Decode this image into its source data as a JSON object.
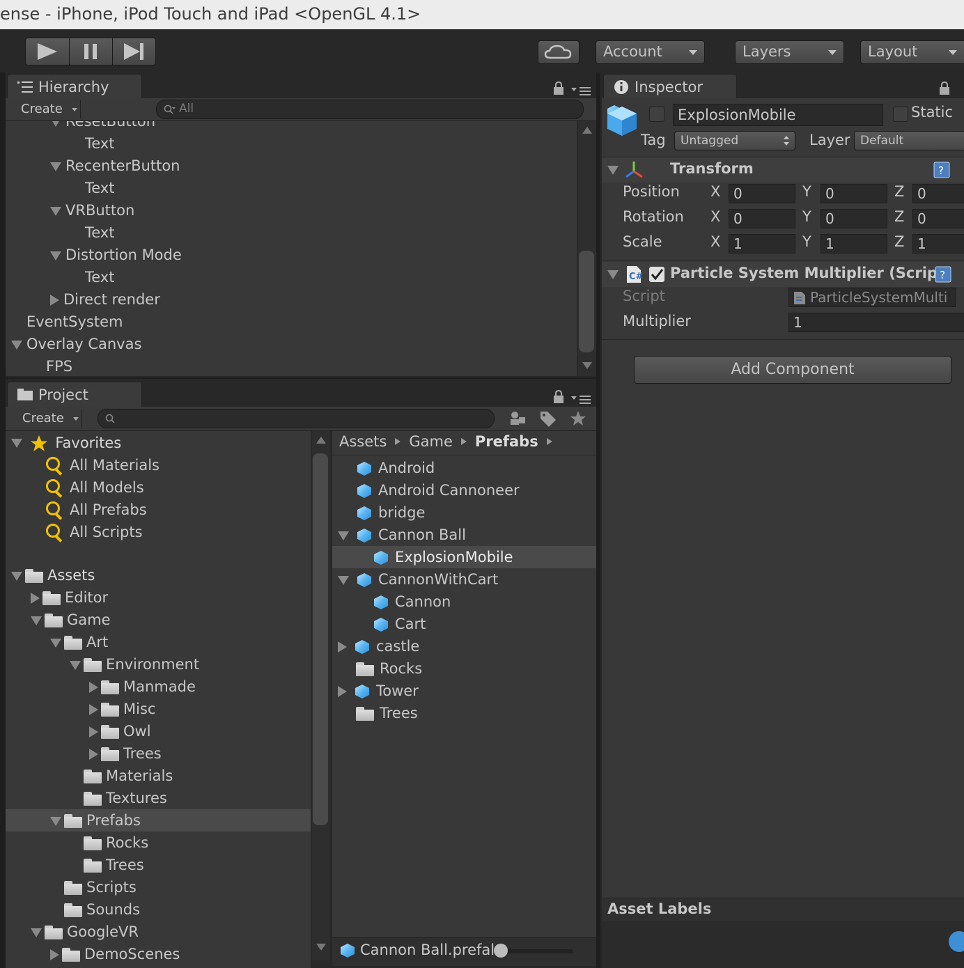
{
  "window": {
    "title": "ense - iPhone, iPod Touch and iPad <OpenGL 4.1>"
  },
  "toolbar": {
    "account": "Account",
    "layers": "Layers",
    "layout": "Layout"
  },
  "hierarchy": {
    "tab": "Hierarchy",
    "create": "Create",
    "search_placeholder": "All",
    "items": [
      {
        "label": "ResetButton",
        "indent": 3,
        "expander": "down"
      },
      {
        "label": "Text",
        "indent": 4,
        "expander": "none"
      },
      {
        "label": "RecenterButton",
        "indent": 3,
        "expander": "down"
      },
      {
        "label": "Text",
        "indent": 4,
        "expander": "none"
      },
      {
        "label": "VRButton",
        "indent": 3,
        "expander": "down"
      },
      {
        "label": "Text",
        "indent": 4,
        "expander": "none"
      },
      {
        "label": "Distortion Mode",
        "indent": 3,
        "expander": "down"
      },
      {
        "label": "Text",
        "indent": 4,
        "expander": "none"
      },
      {
        "label": "Direct render",
        "indent": 3,
        "expander": "right"
      },
      {
        "label": "EventSystem",
        "indent": 1,
        "expander": "none"
      },
      {
        "label": "Overlay Canvas",
        "indent": 1,
        "expander": "down"
      },
      {
        "label": "FPS",
        "indent": 2,
        "expander": "none"
      }
    ]
  },
  "project": {
    "tab": "Project",
    "create": "Create",
    "breadcrumb": [
      "Assets",
      "Game",
      "Prefabs"
    ],
    "favorites": {
      "label": "Favorites",
      "items": [
        "All Materials",
        "All Models",
        "All Prefabs",
        "All Scripts"
      ]
    },
    "tree": [
      {
        "label": "Assets",
        "level": 0,
        "expander": "down",
        "bold": true
      },
      {
        "label": "Editor",
        "level": 1,
        "expander": "right"
      },
      {
        "label": "Game",
        "level": 1,
        "expander": "down"
      },
      {
        "label": "Art",
        "level": 2,
        "expander": "down"
      },
      {
        "label": "Environment",
        "level": 3,
        "expander": "down"
      },
      {
        "label": "Manmade",
        "level": 4,
        "expander": "right"
      },
      {
        "label": "Misc",
        "level": 4,
        "expander": "right"
      },
      {
        "label": "Owl",
        "level": 4,
        "expander": "right"
      },
      {
        "label": "Trees",
        "level": 4,
        "expander": "right"
      },
      {
        "label": "Materials",
        "level": 3,
        "expander": "none"
      },
      {
        "label": "Textures",
        "level": 3,
        "expander": "none"
      },
      {
        "label": "Prefabs",
        "level": 2,
        "expander": "down",
        "selected": true
      },
      {
        "label": "Rocks",
        "level": 3,
        "expander": "none"
      },
      {
        "label": "Trees",
        "level": 3,
        "expander": "none"
      },
      {
        "label": "Scripts",
        "level": 2,
        "expander": "none"
      },
      {
        "label": "Sounds",
        "level": 2,
        "expander": "none"
      },
      {
        "label": "GoogleVR",
        "level": 1,
        "expander": "down"
      },
      {
        "label": "DemoScenes",
        "level": 2,
        "expander": "right"
      }
    ],
    "assets": [
      {
        "label": "Android",
        "level": 0,
        "expander": "none",
        "icon": "prefab"
      },
      {
        "label": "Android Cannoneer",
        "level": 0,
        "expander": "none",
        "icon": "prefab"
      },
      {
        "label": "bridge",
        "level": 0,
        "expander": "none",
        "icon": "prefab"
      },
      {
        "label": "Cannon Ball",
        "level": 0,
        "expander": "down",
        "icon": "prefab"
      },
      {
        "label": "ExplosionMobile",
        "level": 1,
        "expander": "none",
        "icon": "prefab",
        "selected": true
      },
      {
        "label": "CannonWithCart",
        "level": 0,
        "expander": "down",
        "icon": "prefab"
      },
      {
        "label": "Cannon",
        "level": 1,
        "expander": "none",
        "icon": "prefab"
      },
      {
        "label": "Cart",
        "level": 1,
        "expander": "none",
        "icon": "prefab"
      },
      {
        "label": "castle",
        "level": 0,
        "expander": "right",
        "icon": "prefab"
      },
      {
        "label": "Rocks",
        "level": 0,
        "expander": "none",
        "icon": "folder"
      },
      {
        "label": "Tower",
        "level": 0,
        "expander": "right",
        "icon": "prefab"
      },
      {
        "label": "Trees",
        "level": 0,
        "expander": "none",
        "icon": "folder"
      }
    ],
    "status_file": "Cannon Ball.prefal"
  },
  "inspector": {
    "tab": "Inspector",
    "object_name": "ExplosionMobile",
    "static_label": "Static",
    "tag_label": "Tag",
    "tag_value": "Untagged",
    "layer_label": "Layer",
    "layer_value": "Default",
    "transform": {
      "title": "Transform",
      "position_label": "Position",
      "rotation_label": "Rotation",
      "scale_label": "Scale",
      "position": {
        "x": "0",
        "y": "0",
        "z": "0"
      },
      "rotation": {
        "x": "0",
        "y": "0",
        "z": "0"
      },
      "scale": {
        "x": "1",
        "y": "1",
        "z": "1"
      }
    },
    "script_component": {
      "title": "Particle System Multiplier (Script)",
      "script_label": "Script",
      "script_value": "ParticleSystemMulti",
      "multiplier_label": "Multiplier",
      "multiplier_value": "1"
    },
    "add_component": "Add Component",
    "asset_labels": "Asset Labels"
  },
  "axis_letters": {
    "x": "X",
    "y": "Y",
    "z": "Z"
  },
  "colors": {
    "panel": "#383838",
    "selection": "#4a4a4a",
    "accent_blue": "#3d8fd6",
    "favorites_yellow": "#f2c200"
  }
}
